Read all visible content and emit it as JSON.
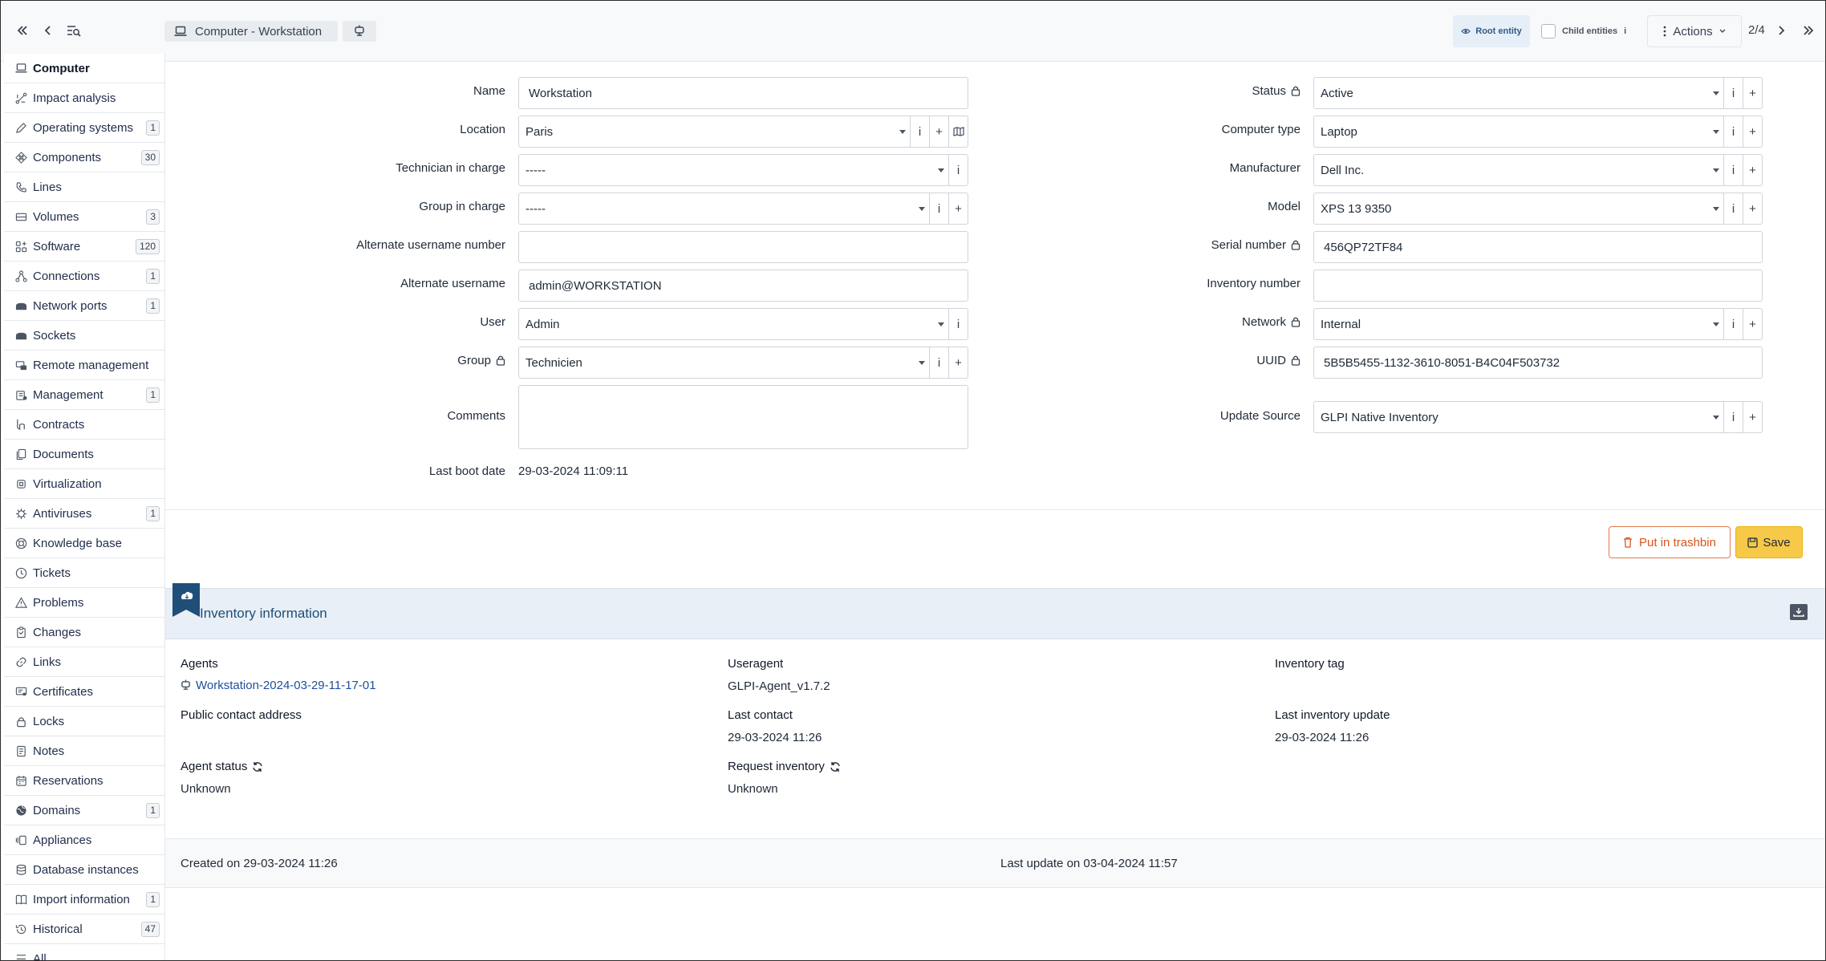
{
  "topbar": {
    "breadcrumb": "Computer -  Workstation",
    "root_entity": "Root entity",
    "child_entities": "Child entities",
    "actions": "Actions",
    "pager": "2/4"
  },
  "sidebar": {
    "items": [
      {
        "label": "Computer",
        "badge": "",
        "icon": "laptop-icon"
      },
      {
        "label": "Impact analysis",
        "badge": "",
        "icon": "graph-icon"
      },
      {
        "label": "Operating systems",
        "badge": "1",
        "icon": "pencil-icon"
      },
      {
        "label": "Components",
        "badge": "30",
        "icon": "components-icon"
      },
      {
        "label": "Lines",
        "badge": "",
        "icon": "phone-icon"
      },
      {
        "label": "Volumes",
        "badge": "3",
        "icon": "drive-icon"
      },
      {
        "label": "Software",
        "badge": "120",
        "icon": "apps-icon"
      },
      {
        "label": "Connections",
        "badge": "1",
        "icon": "hierarchy-icon"
      },
      {
        "label": "Network ports",
        "badge": "1",
        "icon": "network-icon"
      },
      {
        "label": "Sockets",
        "badge": "",
        "icon": "socket-icon"
      },
      {
        "label": "Remote management",
        "badge": "",
        "icon": "remote-icon"
      },
      {
        "label": "Management",
        "badge": "1",
        "icon": "wallet-icon"
      },
      {
        "label": "Contracts",
        "badge": "",
        "icon": "contract-icon"
      },
      {
        "label": "Documents",
        "badge": "",
        "icon": "files-icon"
      },
      {
        "label": "Virtualization",
        "badge": "",
        "icon": "cpu-icon"
      },
      {
        "label": "Antiviruses",
        "badge": "1",
        "icon": "virus-icon"
      },
      {
        "label": "Knowledge base",
        "badge": "",
        "icon": "lifebuoy-icon"
      },
      {
        "label": "Tickets",
        "badge": "",
        "icon": "alert-circle-icon"
      },
      {
        "label": "Problems",
        "badge": "",
        "icon": "alert-triangle-icon"
      },
      {
        "label": "Changes",
        "badge": "",
        "icon": "clipboard-icon"
      },
      {
        "label": "Links",
        "badge": "",
        "icon": "link-icon"
      },
      {
        "label": "Certificates",
        "badge": "",
        "icon": "certificate-icon"
      },
      {
        "label": "Locks",
        "badge": "",
        "icon": "lock-icon"
      },
      {
        "label": "Notes",
        "badge": "",
        "icon": "notes-icon"
      },
      {
        "label": "Reservations",
        "badge": "",
        "icon": "calendar-icon"
      },
      {
        "label": "Domains",
        "badge": "1",
        "icon": "world-icon"
      },
      {
        "label": "Appliances",
        "badge": "",
        "icon": "versions-icon"
      },
      {
        "label": "Database instances",
        "badge": "",
        "icon": "database-icon"
      },
      {
        "label": "Import information",
        "badge": "1",
        "icon": "book-icon"
      },
      {
        "label": "Historical",
        "badge": "47",
        "icon": "history-icon"
      },
      {
        "label": "All",
        "badge": "",
        "icon": "list-icon"
      }
    ]
  },
  "form": {
    "name": {
      "label": "Name",
      "value": "Workstation"
    },
    "location": {
      "label": "Location",
      "value": "Paris"
    },
    "technician": {
      "label": "Technician in charge",
      "value": "-----"
    },
    "group_in_charge": {
      "label": "Group in charge",
      "value": "-----"
    },
    "alt_username_number": {
      "label": "Alternate username number",
      "value": ""
    },
    "alt_username": {
      "label": "Alternate username",
      "value": "admin@WORKSTATION"
    },
    "user": {
      "label": "User",
      "value": "Admin"
    },
    "group": {
      "label": "Group",
      "value": "Technicien"
    },
    "comments": {
      "label": "Comments",
      "value": ""
    },
    "last_boot": {
      "label": "Last boot date",
      "value": "29-03-2024 11:09:11"
    },
    "status": {
      "label": "Status",
      "value": "Active"
    },
    "computer_type": {
      "label": "Computer type",
      "value": "Laptop"
    },
    "manufacturer": {
      "label": "Manufacturer",
      "value": "Dell Inc."
    },
    "model": {
      "label": "Model",
      "value": "XPS 13 9350"
    },
    "serial": {
      "label": "Serial number",
      "value": "456QP72TF84"
    },
    "inventory_number": {
      "label": "Inventory number",
      "value": ""
    },
    "network": {
      "label": "Network",
      "value": "Internal"
    },
    "uuid": {
      "label": "UUID",
      "value": "5B5B5455-1132-3610-8051-B4C04F503732"
    },
    "update_source": {
      "label": "Update Source",
      "value": "GLPI Native Inventory"
    }
  },
  "buttons": {
    "trash": "Put in trashbin",
    "save": "Save"
  },
  "inventory": {
    "title": "Inventory information",
    "agents_label": "Agents",
    "agents_value": "Workstation-2024-03-29-11-17-01",
    "useragent_label": "Useragent",
    "useragent_value": "GLPI-Agent_v1.7.2",
    "tag_label": "Inventory tag",
    "public_contact_label": "Public contact address",
    "last_contact_label": "Last contact",
    "last_contact_value": "29-03-2024 11:26",
    "last_inventory_label": "Last inventory update",
    "last_inventory_value": "29-03-2024 11:26",
    "agent_status_label": "Agent status",
    "agent_status_value": "Unknown",
    "request_inventory_label": "Request inventory",
    "request_inventory_value": "Unknown"
  },
  "footer": {
    "created": "Created on 29-03-2024 11:26",
    "updated": "Last update on 03-04-2024 11:57"
  },
  "colors": {
    "accent": "#1f4e79",
    "save": "#f7c948",
    "trash": "#d9541e"
  }
}
